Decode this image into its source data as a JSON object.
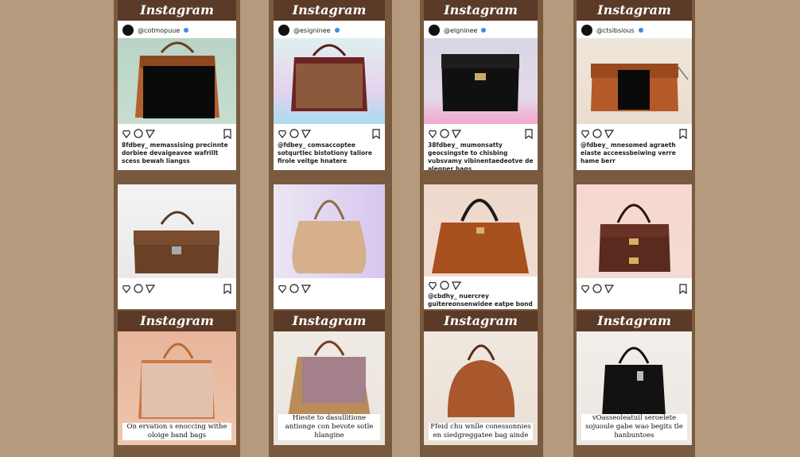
{
  "brand": "Instagram",
  "colors": {
    "page_bg": "#b59a7e",
    "strip": "#7a5a3e",
    "header": "#5b3a27",
    "verified": "#3b8fe0"
  },
  "row1": [
    {
      "handle": "@cotmopuue",
      "caption": "8fdbey_ memassising precinnte dorbiee devaigeavee wafrillt scess bewah liangss"
    },
    {
      "handle": "@esigninee",
      "caption": "@fdbey_ comsaccoptee sotqurtlec bistotiony taliore firole veitge hnatere"
    },
    {
      "handle": "@elgninee",
      "caption": "38fdbey_ mumonsatty geocsingste to chisbing vubsvamy vibinentaedeotve de alegner hags"
    },
    {
      "handle": "@ctsibsious",
      "caption": "@fdbey_ mnesomed agraeth eiaste acceessbeiwing verre hame berr"
    }
  ],
  "row2": [
    {
      "caption": ""
    },
    {
      "caption": ""
    },
    {
      "caption": "@cbdhy_ nuercrey guitereonsenwidee eatpe bond bledes"
    },
    {
      "caption": ""
    }
  ],
  "row3": [
    {
      "caption": "On ervation s enoccing withe oloige band bags"
    },
    {
      "caption": "Hieste to dasullitione antionge con bevote sotle hlangine"
    },
    {
      "caption": "Ffeid chu wnlle conessonnies en siedgreggatee bag ainde"
    },
    {
      "caption": "vOasseoleatuil seroelete sojuoule gabe wao begits tle hanbuntoes"
    }
  ]
}
